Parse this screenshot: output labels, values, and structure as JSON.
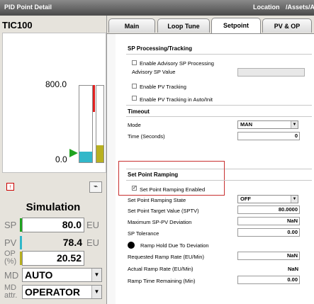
{
  "window": {
    "title": "PID Point Detail",
    "location_label": "Location",
    "location_path": "/Assets/A"
  },
  "left_panel": {
    "tag": "TIC100",
    "bar_top": "800.0",
    "bar_bottom": "0.0",
    "mode_name": "Simulation",
    "sp": {
      "label": "SP",
      "value": "80.0",
      "unit": "EU"
    },
    "pv": {
      "label": "PV",
      "value": "78.4",
      "unit": "EU"
    },
    "op": {
      "label": "OP\n(%)",
      "value": "20.52"
    },
    "md": {
      "label": "MD",
      "value": "AUTO"
    },
    "md_attr": {
      "label": "MD\nattr.",
      "value": "OPERATOR"
    }
  },
  "tabs": [
    "Main",
    "Loop Tune",
    "Setpoint",
    "PV & OP"
  ],
  "active_tab": "Setpoint",
  "sp_processing": {
    "title": "SP Processing/Tracking",
    "enable_advisory": "Enable Advisory SP Processing",
    "advisory_sp_value": "Advisory SP Value",
    "enable_pv_tracking": "Enable PV Tracking",
    "enable_pv_tracking_auto": "Enable PV Tracking in Auto/Init"
  },
  "timeout": {
    "title": "Timeout",
    "mode_label": "Mode",
    "mode_value": "MAN",
    "time_label": "Time (Seconds)",
    "time_value": "0"
  },
  "ramping": {
    "title": "Set Point Ramping",
    "enabled_label": "Set Point Ramping Enabled",
    "enabled_checked": true,
    "state_label": "Set Point Ramping State",
    "state_value": "OFF",
    "target_label": "Set Point Target Value (SPTV)",
    "target_value": "80.0000",
    "max_dev_label": "Maximum SP-PV Deviation",
    "max_dev_value": "NaN",
    "tolerance_label": "SP Tolerance",
    "tolerance_value": "0.00",
    "hold_label": "Ramp Hold Due To Deviation",
    "req_rate_label": "Requested Ramp Rate (EU/Min)",
    "req_rate_value": "NaN",
    "act_rate_label": "Actual Ramp Rate (EU/Min)",
    "act_rate_value": "NaN",
    "time_remaining_label": "Ramp Time Remaining (Min)",
    "time_remaining_value": "0.00"
  },
  "colors": {
    "pv_bar": "#31b7c9",
    "op_bar": "#b8b020",
    "sp_marker": "#1fa31f",
    "sp_bar_red": "#e02020",
    "highlight_box": "#c83030"
  }
}
